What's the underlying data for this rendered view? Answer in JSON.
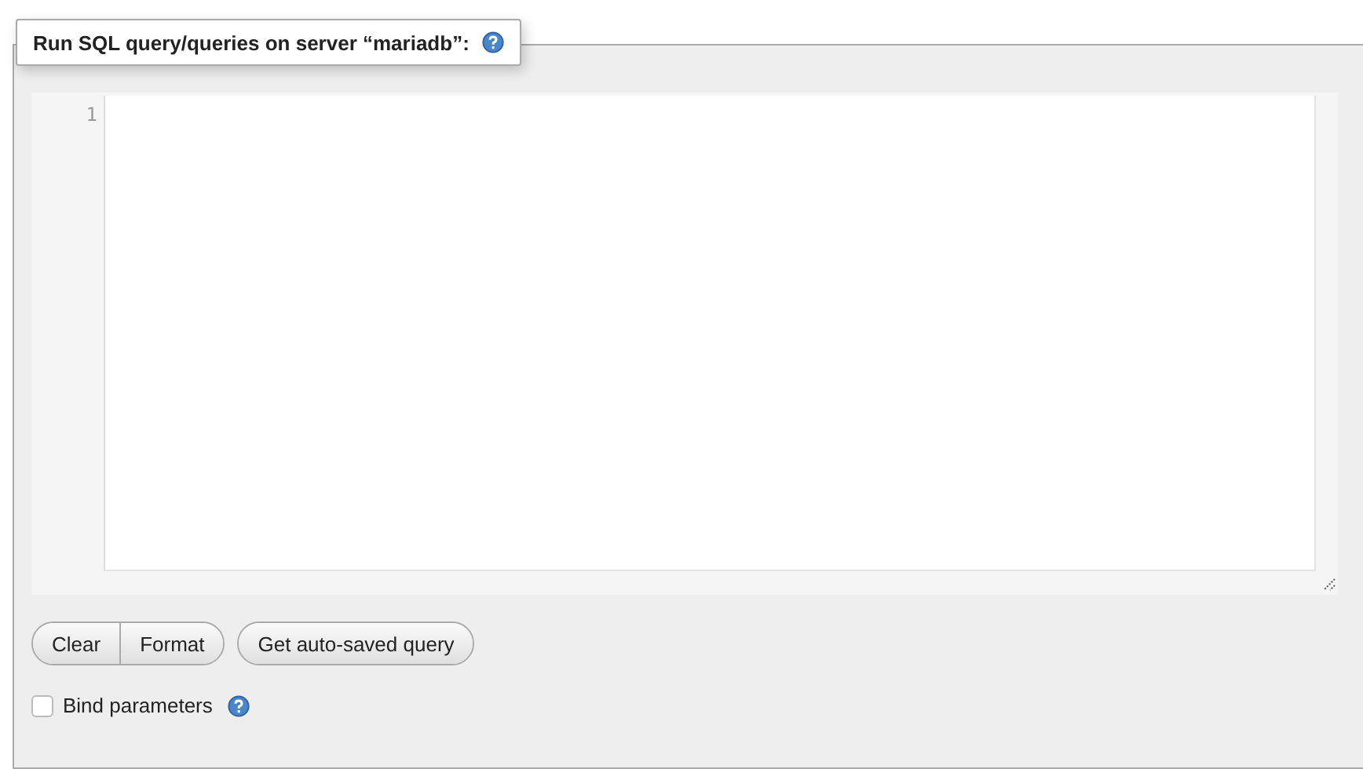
{
  "panel": {
    "legend": "Run SQL query/queries on server “mariadb”:"
  },
  "editor": {
    "line_numbers": [
      "1"
    ]
  },
  "button_groups": [
    [
      "Clear",
      "Format"
    ],
    [
      "Get auto-saved query"
    ]
  ],
  "options": [
    {
      "label": "Bind parameters",
      "checked": false
    }
  ]
}
